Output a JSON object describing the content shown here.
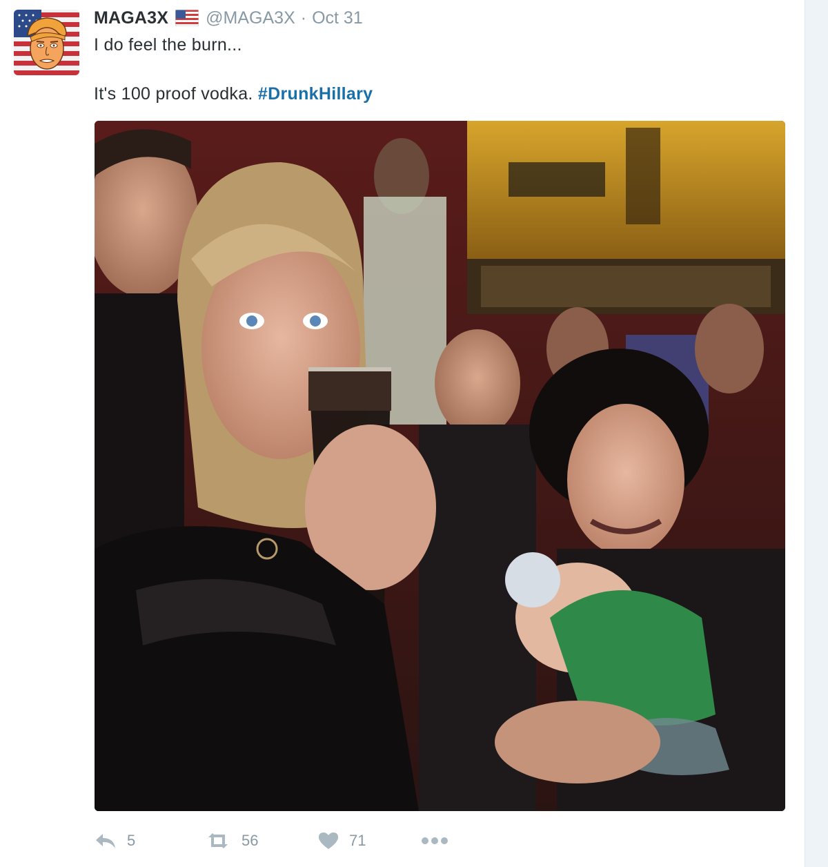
{
  "tweet": {
    "display_name": "MAGA3X",
    "screen_name": "@MAGA3X",
    "separator": "·",
    "timestamp": "Oct 31",
    "verified_flag_icon": "us-flag-icon",
    "text_line_1": "I do feel the burn...",
    "text_line_2": "It's 100 proof vodka.",
    "hashtag": "#DrunkHillary",
    "media_description": "photo"
  },
  "actions": {
    "reply": {
      "icon": "reply-icon",
      "count": "5"
    },
    "retweet": {
      "icon": "retweet-icon",
      "count": "56"
    },
    "like": {
      "icon": "heart-icon",
      "count": "71"
    },
    "more": {
      "icon": "more-dots-icon"
    }
  },
  "colors": {
    "text": "#292f33",
    "muted": "#8899a6",
    "hashtag": "#1b6fa8",
    "icon": "#aab8c2"
  }
}
